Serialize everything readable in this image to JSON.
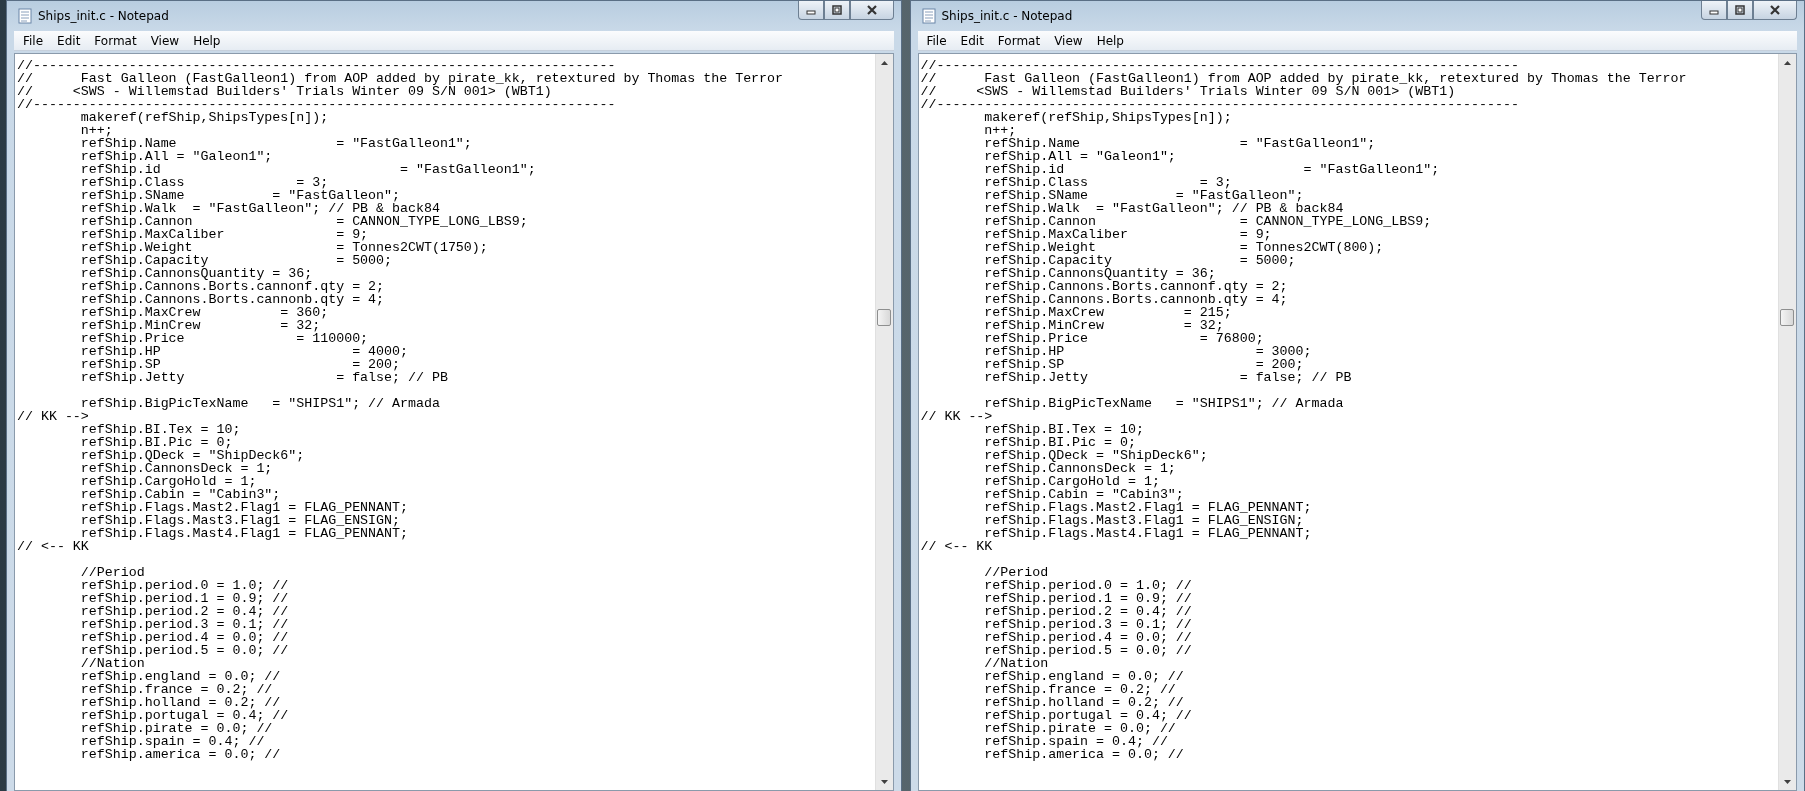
{
  "windows": [
    {
      "title": "Ships_init.c - Notepad",
      "menu": [
        "File",
        "Edit",
        "Format",
        "View",
        "Help"
      ],
      "blocks": [
        [
          "//-------------------------------------------------------------------------",
          "//      Fast Galleon (FastGalleon1) from AOP added by pirate_kk, retextured by Thomas the Terror",
          "//     <SWS - Willemstad Builders' Trials Winter 09 S/N 001> (WBT1)",
          "//-------------------------------------------------------------------------",
          "        makeref(refShip,ShipsTypes[n]);",
          "        n++;",
          "        refShip.Name                    = \"FastGalleon1\";",
          "        refShip.All = \"Galeon1\";",
          "        refShip.id                              = \"FastGalleon1\";",
          "        refShip.Class              = 3;",
          "        refShip.SName           = \"FastGalleon\";",
          "        refShip.Walk  = \"FastGalleon\"; // PB & back84",
          "        refShip.Cannon                  = CANNON_TYPE_LONG_LBS9;",
          "        refShip.MaxCaliber              = 9;",
          "        refShip.Weight                  = Tonnes2CWT(1750);",
          "        refShip.Capacity                = 5000;",
          "        refShip.CannonsQuantity = 36;",
          "        refShip.Cannons.Borts.cannonf.qty = 2;",
          "        refShip.Cannons.Borts.cannonb.qty = 4;",
          "        refShip.MaxCrew          = 360;",
          "        refShip.MinCrew          = 32;",
          "        refShip.Price              = 110000;",
          "        refShip.HP                        = 4000;",
          "        refShip.SP                        = 200;",
          "        refShip.Jetty                   = false; // PB"
        ],
        [
          "        refShip.BigPicTexName   = \"SHIPS1\"; // Armada",
          "// KK -->",
          "        refShip.BI.Tex = 10;",
          "        refShip.BI.Pic = 0;",
          "        refShip.QDeck = \"ShipDeck6\";",
          "        refShip.CannonsDeck = 1;",
          "        refShip.CargoHold = 1;",
          "        refShip.Cabin = \"Cabin3\";",
          "        refShip.Flags.Mast2.Flag1 = FLAG_PENNANT;",
          "        refShip.Flags.Mast3.Flag1 = FLAG_ENSIGN;",
          "        refShip.Flags.Mast4.Flag1 = FLAG_PENNANT;",
          "// <-- KK"
        ],
        [
          "        //Period",
          "        refShip.period.0 = 1.0; //",
          "        refShip.period.1 = 0.9; //",
          "        refShip.period.2 = 0.4; //",
          "        refShip.period.3 = 0.1; //",
          "        refShip.period.4 = 0.0; //",
          "        refShip.period.5 = 0.0; //",
          "        //Nation",
          "        refShip.england = 0.0; //",
          "        refShip.france = 0.2; //",
          "        refShip.holland = 0.2; //",
          "        refShip.portugal = 0.4; //",
          "        refShip.pirate = 0.0; //",
          "        refShip.spain = 0.4; //",
          "        refShip.america = 0.0; //"
        ]
      ]
    },
    {
      "title": "Ships_init.c - Notepad",
      "menu": [
        "File",
        "Edit",
        "Format",
        "View",
        "Help"
      ],
      "blocks": [
        [
          "//-------------------------------------------------------------------------",
          "//      Fast Galleon (FastGalleon1) from AOP added by pirate_kk, retextured by Thomas the Terror",
          "//     <SWS - Willemstad Builders' Trials Winter 09 S/N 001> (WBT1)",
          "//-------------------------------------------------------------------------",
          "        makeref(refShip,ShipsTypes[n]);",
          "        n++;",
          "        refShip.Name                    = \"FastGalleon1\";",
          "        refShip.All = \"Galeon1\";",
          "        refShip.id                              = \"FastGalleon1\";",
          "        refShip.Class              = 3;",
          "        refShip.SName           = \"FastGalleon\";",
          "        refShip.Walk  = \"FastGalleon\"; // PB & back84",
          "        refShip.Cannon                  = CANNON_TYPE_LONG_LBS9;",
          "        refShip.MaxCaliber              = 9;",
          "        refShip.Weight                  = Tonnes2CWT(800);",
          "        refShip.Capacity                = 5000;",
          "        refShip.CannonsQuantity = 36;",
          "        refShip.Cannons.Borts.cannonf.qty = 2;",
          "        refShip.Cannons.Borts.cannonb.qty = 4;",
          "        refShip.MaxCrew          = 215;",
          "        refShip.MinCrew          = 32;",
          "        refShip.Price              = 76800;",
          "        refShip.HP                        = 3000;",
          "        refShip.SP                        = 200;",
          "        refShip.Jetty                   = false; // PB"
        ],
        [
          "        refShip.BigPicTexName   = \"SHIPS1\"; // Armada",
          "// KK -->",
          "        refShip.BI.Tex = 10;",
          "        refShip.BI.Pic = 0;",
          "        refShip.QDeck = \"ShipDeck6\";",
          "        refShip.CannonsDeck = 1;",
          "        refShip.CargoHold = 1;",
          "        refShip.Cabin = \"Cabin3\";",
          "        refShip.Flags.Mast2.Flag1 = FLAG_PENNANT;",
          "        refShip.Flags.Mast3.Flag1 = FLAG_ENSIGN;",
          "        refShip.Flags.Mast4.Flag1 = FLAG_PENNANT;",
          "// <-- KK"
        ],
        [
          "        //Period",
          "        refShip.period.0 = 1.0; //",
          "        refShip.period.1 = 0.9; //",
          "        refShip.period.2 = 0.4; //",
          "        refShip.period.3 = 0.1; //",
          "        refShip.period.4 = 0.0; //",
          "        refShip.period.5 = 0.0; //",
          "        //Nation",
          "        refShip.england = 0.0; //",
          "        refShip.france = 0.2; //",
          "        refShip.holland = 0.2; //",
          "        refShip.portugal = 0.4; //",
          "        refShip.pirate = 0.0; //",
          "        refShip.spain = 0.4; //",
          "        refShip.america = 0.0; //"
        ]
      ]
    }
  ]
}
